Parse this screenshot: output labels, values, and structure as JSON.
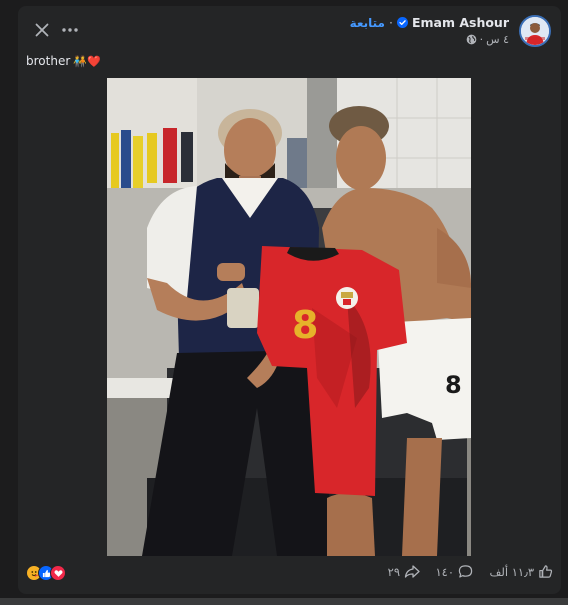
{
  "post": {
    "author_name": "Emam Ashour",
    "follow_label": "متابعة",
    "separator": "·",
    "time_ago": "٤ س",
    "meta_separator": "·",
    "caption_text": "brother",
    "caption_emojis": "🧑‍🤝‍🧑❤️"
  },
  "photo": {
    "jersey_number": "8",
    "shorts_number": "8"
  },
  "footer": {
    "likes_count": "١١٫٣ ألف",
    "comments_count": "١٤٠",
    "shares_count": "٢٩"
  },
  "icons": {
    "close": "close-icon",
    "more": "more-icon",
    "verified": "verified-badge-icon",
    "globe": "globe-icon",
    "like": "thumbs-up-icon",
    "comment": "comment-icon",
    "share": "share-icon",
    "reaction_care": "care-reaction-icon",
    "reaction_like": "like-reaction-icon",
    "reaction_love": "love-reaction-icon"
  },
  "colors": {
    "background": "#1c1c1d",
    "card": "#242526",
    "follow_blue": "#4599ff",
    "verified_blue": "#0866ff",
    "love_red": "#f02849",
    "jersey_red": "#d8262a"
  }
}
